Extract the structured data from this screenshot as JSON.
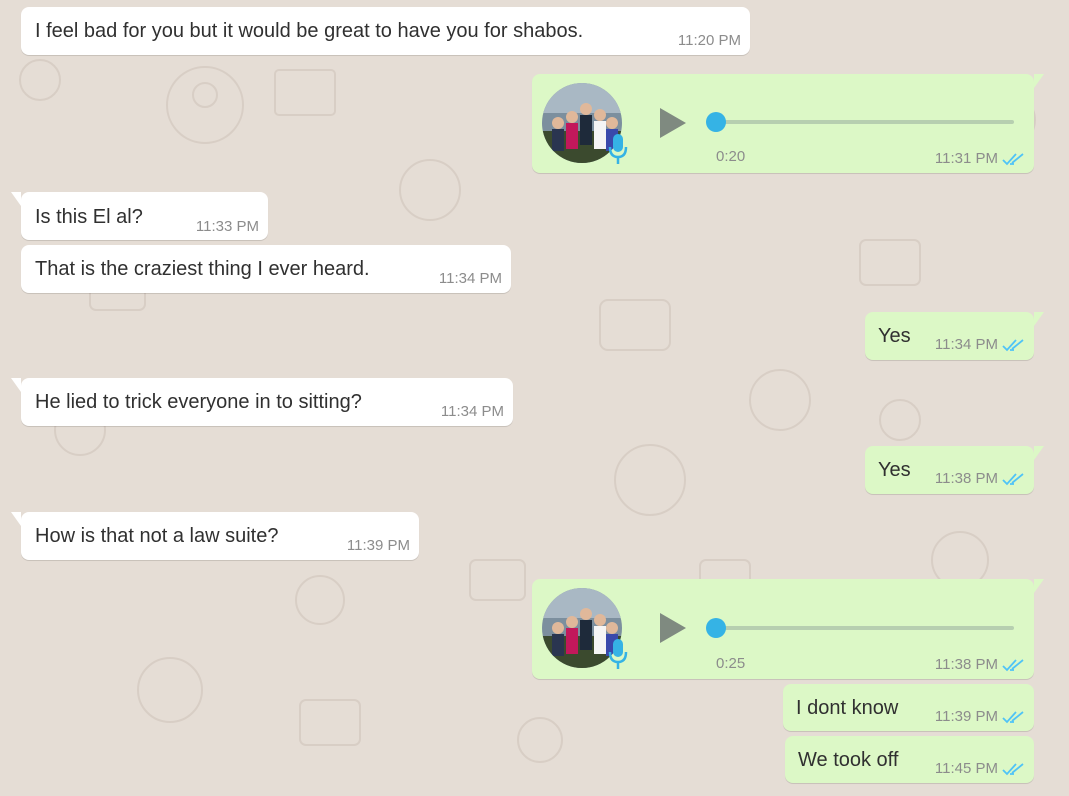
{
  "messages": [
    {
      "text": "I feel bad for you but it would be great to have you for shabos.",
      "time": "11:20 PM"
    },
    {
      "voice_duration": "0:20",
      "time": "11:31 PM"
    },
    {
      "text": "Is this El al?",
      "time": "11:33 PM"
    },
    {
      "text": "That is the craziest thing I ever heard.",
      "time": "11:34 PM"
    },
    {
      "text": "Yes",
      "time": "11:34 PM"
    },
    {
      "text": "He lied to trick everyone in to sitting?",
      "time": "11:34 PM"
    },
    {
      "text": "Yes",
      "time": "11:38 PM"
    },
    {
      "text": "How is that not a law suite?",
      "time": "11:39 PM"
    },
    {
      "voice_duration": "0:25",
      "time": "11:38 PM"
    },
    {
      "text": "I dont know",
      "time": "11:39 PM"
    },
    {
      "text": "We took off",
      "time": "11:45 PM"
    }
  ],
  "colors": {
    "background": "#e5ddd5",
    "incoming_bubble": "#ffffff",
    "outgoing_bubble": "#dcf8c6",
    "read_ticks": "#4fc3f7",
    "voice_accent": "#35b3e5"
  },
  "icons": {
    "play": "play-icon",
    "mic": "microphone-icon",
    "read_receipt": "double-check-icon"
  }
}
